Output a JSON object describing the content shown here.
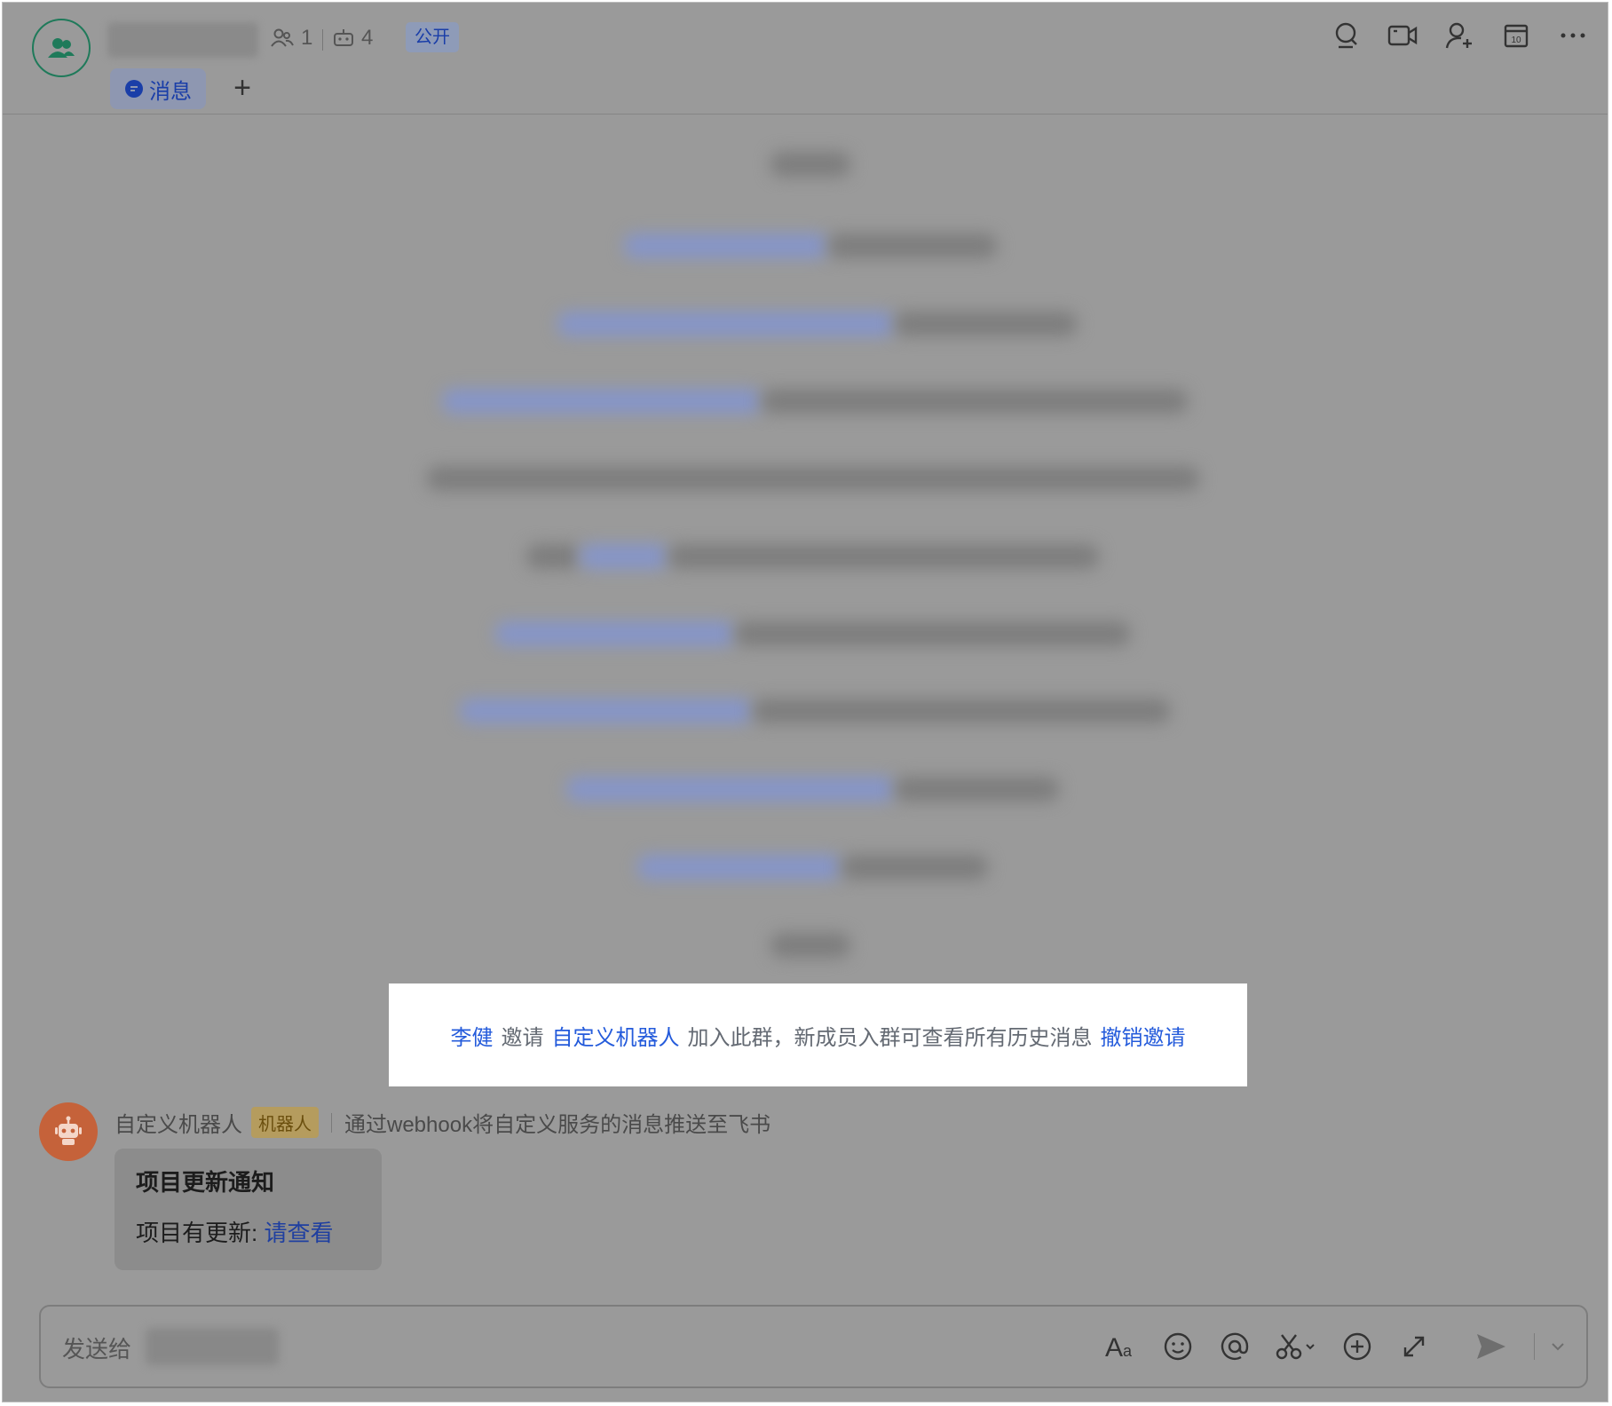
{
  "header": {
    "member_count": "1",
    "bot_count": "4",
    "public_badge": "公开",
    "tabs": [
      {
        "label": "消息"
      }
    ],
    "add_tab_label": "+"
  },
  "notice": {
    "inviter": "李健",
    "verb": "邀请",
    "invitee": "自定义机器人",
    "message": "加入此群，新成员入群可查看所有历史消息",
    "revoke": "撤销邀请"
  },
  "bot_message": {
    "sender": "自定义机器人",
    "tag": "机器人",
    "description": "通过webhook将自定义服务的消息推送至飞书",
    "card": {
      "title": "项目更新通知",
      "body_prefix": "项目有更新:",
      "body_link": "请查看"
    }
  },
  "composer": {
    "placeholder": "发送给"
  },
  "icons": {
    "header_actions": [
      "search-icon",
      "video-call-icon",
      "add-member-icon",
      "calendar-icon",
      "more-icon"
    ],
    "toolbar": [
      "text-format-icon",
      "emoji-icon",
      "mention-icon",
      "screenshot-icon",
      "add-icon",
      "expand-icon",
      "send-icon",
      "chevron-down-icon"
    ]
  },
  "colors": {
    "link": "#245bdb",
    "bot_avatar": "#c5623a",
    "group_avatar_border": "#1f7a5a"
  }
}
